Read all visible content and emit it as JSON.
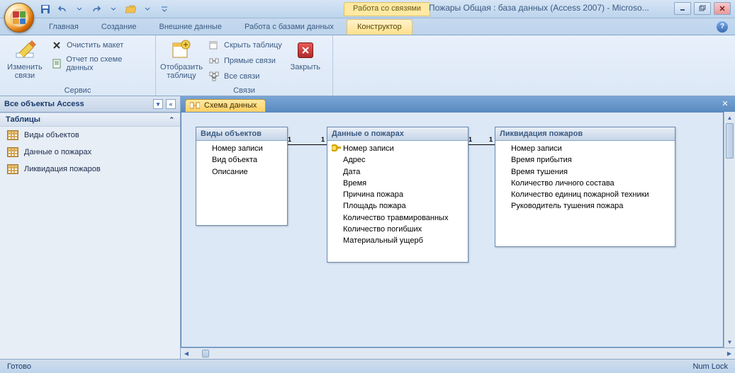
{
  "titlebar": {
    "context_tab": "Работа со связями",
    "title": "Пожары Общая : база данных (Access 2007) - Microso..."
  },
  "tabs": {
    "home": "Главная",
    "create": "Создание",
    "external": "Внешние данные",
    "dbtools": "Работа с базами данных",
    "constructor": "Конструктор"
  },
  "ribbon": {
    "g1": {
      "label": "Сервис",
      "edit_rel": "Изменить связи",
      "clear": "Очистить макет",
      "report": "Отчет по схеме данных"
    },
    "g2": {
      "label": "Связи",
      "show_tbl": "Отобразить таблицу",
      "hide_tbl": "Скрыть таблицу",
      "direct": "Прямые связи",
      "all": "Все связи",
      "close": "Закрыть"
    }
  },
  "nav": {
    "header": "Все объекты Access",
    "group": "Таблицы",
    "items": [
      "Виды объектов",
      "Данные о пожарах",
      "Ликвидация пожаров"
    ]
  },
  "doc_tab": "Схема данных",
  "tables": {
    "t1": {
      "title": "Виды объектов",
      "fields": [
        "Номер записи",
        "Вид объекта",
        "Описание"
      ]
    },
    "t2": {
      "title": "Данные о пожарах",
      "fields": [
        "Номер записи",
        "Адрес",
        "Дата",
        "Время",
        "Причина пожара",
        "Площадь пожара",
        "Количество травмированных",
        "Количество погибших",
        "Материальный ущерб"
      ]
    },
    "t3": {
      "title": "Ликвидация пожаров",
      "fields": [
        "Номер записи",
        "Время прибытия",
        "Время тушения",
        "Количество личного состава",
        "Количество единиц пожарной техники",
        "Руководитель тушения пожара"
      ]
    }
  },
  "rel": {
    "one": "1"
  },
  "status": {
    "ready": "Готово",
    "numlock": "Num Lock"
  }
}
